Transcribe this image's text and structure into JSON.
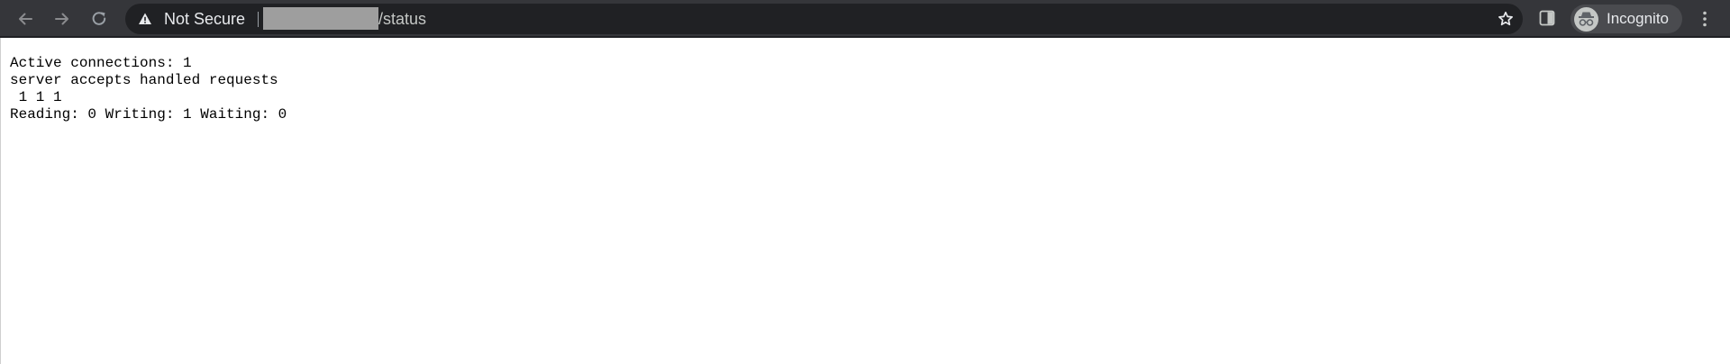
{
  "browser": {
    "security_label": "Not Secure",
    "url_path": "/status",
    "profile_label": "Incognito",
    "icons": {
      "back": "arrow-left-icon",
      "forward": "arrow-right-icon",
      "reload": "reload-icon",
      "security": "warning-triangle-icon",
      "bookmark": "star-icon",
      "side_panel": "side-panel-icon",
      "profile": "incognito-icon",
      "menu": "kebab-menu-icon"
    },
    "colors": {
      "toolbar": "#35363a",
      "omnibox": "#202124",
      "redaction": "#9e9e9e"
    }
  },
  "status": {
    "line1": "Active connections: 1",
    "line2": "server accepts handled requests",
    "line3": " 1 1 1",
    "line4": "Reading: 0 Writing: 1 Waiting: 0"
  }
}
